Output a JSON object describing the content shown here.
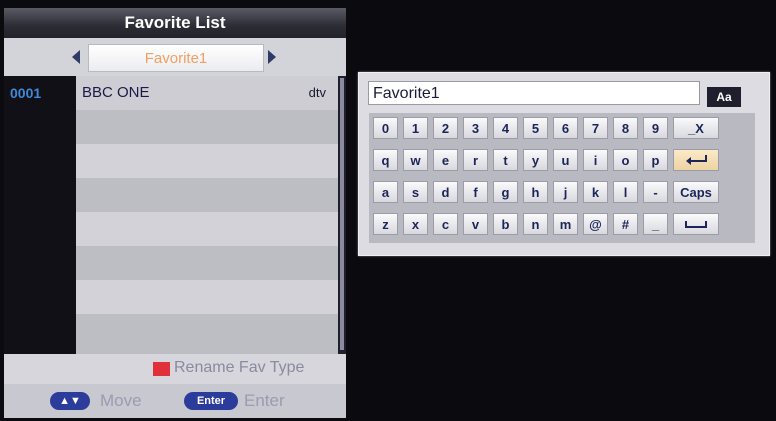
{
  "favorite_panel": {
    "title": "Favorite List",
    "current_favorite": "Favorite1",
    "channels": [
      {
        "number": "0001",
        "name": "BBC ONE",
        "type": "dtv"
      }
    ],
    "rename_label": "Rename Fav Type",
    "rename_key_color": "#e0303a",
    "help": {
      "move_key": "▲▼",
      "move_label": "Move",
      "enter_key": "Enter",
      "enter_label": "Enter"
    }
  },
  "keyboard": {
    "input_value": "Favorite1",
    "case_toggle": "Aa",
    "rows": [
      [
        "0",
        "1",
        "2",
        "3",
        "4",
        "5",
        "6",
        "7",
        "8",
        "9",
        "_X"
      ],
      [
        "q",
        "w",
        "e",
        "r",
        "t",
        "y",
        "u",
        "i",
        "o",
        "p",
        "enter"
      ],
      [
        "a",
        "s",
        "d",
        "f",
        "g",
        "h",
        "j",
        "k",
        "l",
        "-",
        "Caps"
      ],
      [
        "z",
        "x",
        "c",
        "v",
        "b",
        "n",
        "m",
        "@",
        "#",
        "_",
        "space"
      ]
    ],
    "highlighted_key": "enter"
  }
}
